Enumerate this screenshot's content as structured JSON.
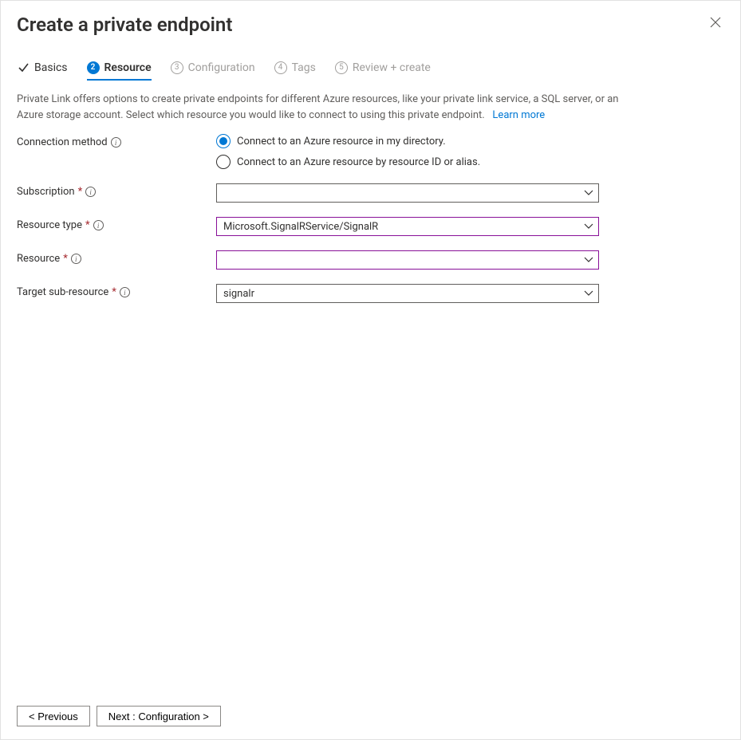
{
  "header": {
    "title": "Create a private endpoint"
  },
  "tabs": {
    "basics": "Basics",
    "resource": "Resource",
    "configuration": "Configuration",
    "tags": "Tags",
    "review": "Review + create",
    "step_num_2": "2",
    "step_num_3": "3",
    "step_num_4": "4",
    "step_num_5": "5"
  },
  "description": {
    "text": "Private Link offers options to create private endpoints for different Azure resources, like your private link service, a SQL server, or an Azure storage account. Select which resource you would like to connect to using this private endpoint.",
    "learn_more": "Learn more"
  },
  "form": {
    "connection_method": {
      "label": "Connection method",
      "option_directory": "Connect to an Azure resource in my directory.",
      "option_resource_id": "Connect to an Azure resource by resource ID or alias.",
      "selected": "directory"
    },
    "subscription": {
      "label": "Subscription",
      "value": ""
    },
    "resource_type": {
      "label": "Resource type",
      "value": "Microsoft.SignalRService/SignalR"
    },
    "resource": {
      "label": "Resource",
      "value": ""
    },
    "target_sub_resource": {
      "label": "Target sub-resource",
      "value": "signalr"
    }
  },
  "footer": {
    "previous": "< Previous",
    "next": "Next : Configuration >"
  }
}
